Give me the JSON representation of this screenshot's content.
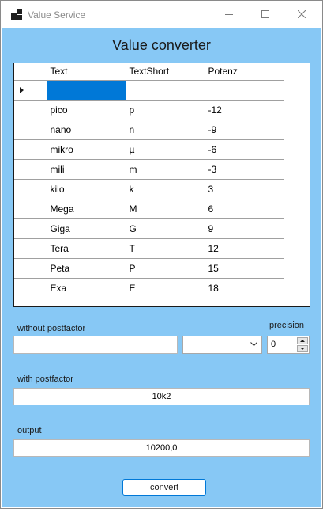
{
  "window": {
    "title": "Value Service",
    "icon": "app-grid-icon",
    "controls": {
      "minimize": "minimize-icon",
      "maximize": "maximize-icon",
      "close": "close-icon"
    }
  },
  "heading": "Value converter",
  "grid": {
    "columns": [
      "Text",
      "TextShort",
      "Potenz"
    ],
    "new_row": [
      "",
      "",
      ""
    ],
    "rows": [
      [
        "pico",
        "p",
        "-12"
      ],
      [
        "nano",
        "n",
        "-9"
      ],
      [
        "mikro",
        "µ",
        "-6"
      ],
      [
        "mili",
        "m",
        "-3"
      ],
      [
        "kilo",
        "k",
        "3"
      ],
      [
        "Mega",
        "M",
        "6"
      ],
      [
        "Giga",
        "G",
        "9"
      ],
      [
        "Tera",
        "T",
        "12"
      ],
      [
        "Peta",
        "P",
        "15"
      ],
      [
        "Exa",
        "E",
        "18"
      ]
    ]
  },
  "without_postfactor": {
    "label": "without postfactor",
    "value": ""
  },
  "postfactor_select": {
    "value": ""
  },
  "precision": {
    "label": "precision",
    "value": "0"
  },
  "with_postfactor": {
    "label": "with postfactor",
    "value": "10k2"
  },
  "output": {
    "label": "output",
    "value": "10200,0"
  },
  "convert_label": "convert",
  "colors": {
    "background": "#87c8f5",
    "selection": "#0078d7",
    "button_border": "#0078d7"
  }
}
